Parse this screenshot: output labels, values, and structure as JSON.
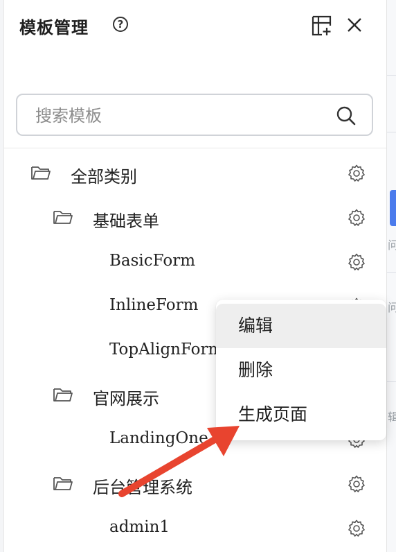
{
  "panel": {
    "title": "模板管理",
    "help_icon_text": "?"
  },
  "search": {
    "placeholder": "搜索模板",
    "value": ""
  },
  "tree": {
    "all": {
      "label": "全部类别"
    },
    "group1": {
      "label": "基础表单",
      "items": [
        "BasicForm",
        "InlineForm",
        "TopAlignForm"
      ]
    },
    "group2": {
      "label": "官网展示",
      "items": [
        "LandingOne"
      ]
    },
    "group3": {
      "label": "后台管理系统",
      "items": [
        "admin1"
      ]
    }
  },
  "context_menu": {
    "items": [
      "编辑",
      "删除",
      "生成页面"
    ],
    "highlighted": "编辑"
  },
  "annotation": {
    "color": "#e8442f"
  },
  "right_strip": {
    "fragments": [
      "问",
      "问",
      "辑"
    ]
  }
}
